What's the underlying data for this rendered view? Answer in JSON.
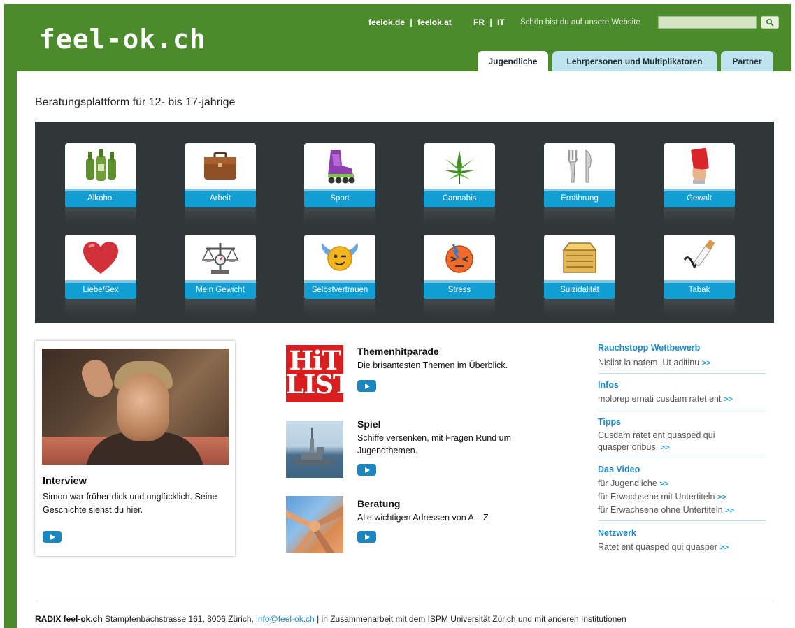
{
  "header": {
    "logo": "feel-ok.ch",
    "link_de": "feelok.de",
    "sep1": "|",
    "link_at": "feelok.at",
    "lang_fr": "FR",
    "sep2": "|",
    "lang_it": "IT",
    "slogan": "Schön bist du auf unsere Website",
    "search_value": ""
  },
  "tabs": [
    {
      "label": "Jugendliche"
    },
    {
      "label": "Lehrpersonen und Multiplikatoren"
    },
    {
      "label": "Partner"
    }
  ],
  "subtitle": "Beratungsplattform für 12- bis 17-jährige",
  "topics": [
    {
      "label": "Alkohol",
      "icon": "bottles-icon"
    },
    {
      "label": "Arbeit",
      "icon": "briefcase-icon"
    },
    {
      "label": "Sport",
      "icon": "inline-skate-icon"
    },
    {
      "label": "Cannabis",
      "icon": "cannabis-leaf-icon"
    },
    {
      "label": "Ernährung",
      "icon": "fork-knife-icon"
    },
    {
      "label": "Gewalt",
      "icon": "red-card-icon"
    },
    {
      "label": "Liebe/Sex",
      "icon": "heart-icon"
    },
    {
      "label": "Mein Gewicht",
      "icon": "scale-icon"
    },
    {
      "label": "Selbstvertrauen",
      "icon": "winged-smiley-icon"
    },
    {
      "label": "Stress",
      "icon": "stressed-face-icon"
    },
    {
      "label": "Suizidalität",
      "icon": "box-icon"
    },
    {
      "label": "Tabak",
      "icon": "cigarette-icon"
    }
  ],
  "interview": {
    "title": "Interview",
    "text": "Simon war früher dick und unglücklich. Seine Geschichte siehst du hier."
  },
  "features": [
    {
      "title": "Themenhitparade",
      "desc": "Die brisantesten Themen im Überblick.",
      "image_text_1": "HiT",
      "image_text_2": "LIST"
    },
    {
      "title": "Spiel",
      "desc": "Schiffe versenken, mit Fragen Rund um Jugendthemen."
    },
    {
      "title": "Beratung",
      "desc": "Alle wichtigen Adressen von A – Z"
    }
  ],
  "sidebar": {
    "arrow": ">>",
    "rauchstopp": {
      "title": "Rauchstopp Wettbewerb",
      "text": "Nisiiat la natem. Ut aditinu"
    },
    "infos": {
      "title": "Infos",
      "text": "molorep ernati cusdam ratet ent"
    },
    "tipps": {
      "title": "Tipps",
      "text": "Cusdam ratet ent quasped qui quasper oribus."
    },
    "video": {
      "title": "Das Video",
      "items": [
        "für Jugendliche",
        "für Erwachsene mit Untertiteln",
        "für Erwachsene ohne Untertiteln"
      ]
    },
    "netzwerk": {
      "title": "Netzwerk",
      "text": "Ratet ent quasped qui quasper"
    }
  },
  "footer": {
    "org": "RADIX feel-ok.ch",
    "address": "Stampfenbachstrasse 161, 8006 Zürich,",
    "email": "info@feel-ok.ch",
    "rest": "| in Zusammenarbeit mit dem ISPM Universität Zürich und mit anderen Institutionen"
  },
  "colors": {
    "green": "#4b8b2c",
    "panel": "#2f3739",
    "accent_blue": "#129dd3",
    "link_blue": "#1a8bc6"
  }
}
